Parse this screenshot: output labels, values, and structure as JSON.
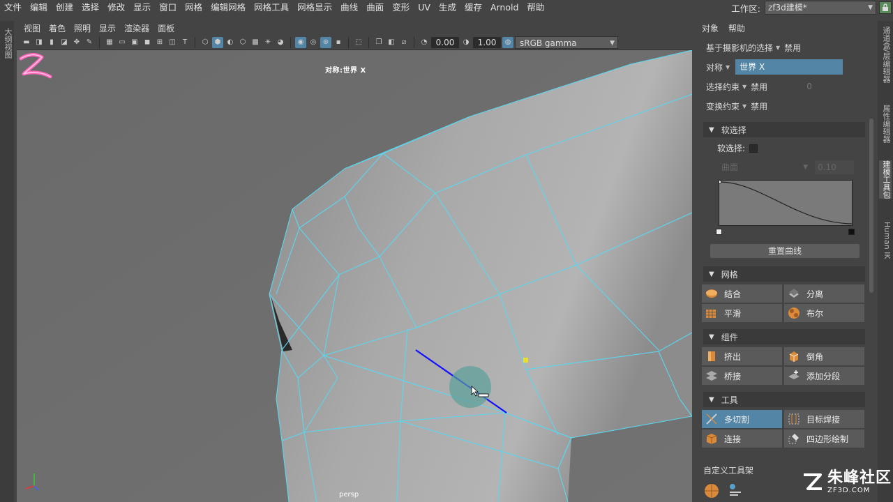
{
  "menubar": {
    "items": [
      "文件",
      "编辑",
      "创建",
      "选择",
      "修改",
      "显示",
      "窗口",
      "网格",
      "编辑网格",
      "网格工具",
      "网格显示",
      "曲线",
      "曲面",
      "变形",
      "UV",
      "生成",
      "缓存",
      "Arnold",
      "帮助"
    ],
    "workspace_label": "工作区:",
    "workspace_value": "zf3d建模*"
  },
  "left_strip": {
    "label": "大纲视图"
  },
  "viewport": {
    "menus": [
      "视图",
      "着色",
      "照明",
      "显示",
      "渲染器",
      "面板"
    ],
    "exposure": "0.00",
    "gamma": "1.00",
    "color_space": "sRGB gamma",
    "symmetry_label": "对称:世界 X",
    "camera_label": "persp"
  },
  "right_panel": {
    "menus": [
      "对象",
      "帮助"
    ],
    "camera_selection_label": "基于摄影机的选择",
    "camera_selection_value": "禁用",
    "symmetry_label": "对称",
    "symmetry_value": "世界 X",
    "select_constraint_label": "选择约束",
    "select_constraint_value": "禁用",
    "select_constraint_num": "0",
    "transform_constraint_label": "变换约束",
    "transform_constraint_value": "禁用",
    "soft_select": {
      "title": "软选择",
      "checkbox_label": "软选择:",
      "falloff_mode": "曲面",
      "falloff_value": "0.10",
      "reset_label": "重置曲线"
    },
    "mesh": {
      "title": "网格",
      "tools": [
        "结合",
        "分离",
        "平滑",
        "布尔"
      ]
    },
    "components": {
      "title": "组件",
      "tools": [
        "挤出",
        "倒角",
        "桥接",
        "添加分段"
      ]
    },
    "tools": {
      "title": "工具",
      "tools": [
        "多切割",
        "目标焊接",
        "连接",
        "四边形绘制"
      ]
    },
    "custom_shelf": "自定义工具架"
  },
  "right_tabs": [
    "通道盒/层编辑器",
    "属性编辑器",
    "建模工具包",
    "Human IK"
  ],
  "watermark": {
    "title": "朱峰社区",
    "sub": "ZF3D.COM"
  },
  "colors": {
    "accent": "#5285a6",
    "wire": "#5ad7f0",
    "selected_edge": "#1010ff",
    "vertex": "#e8e02a",
    "brush": "#5aa09a",
    "logo_pink": "#ff66b8"
  }
}
